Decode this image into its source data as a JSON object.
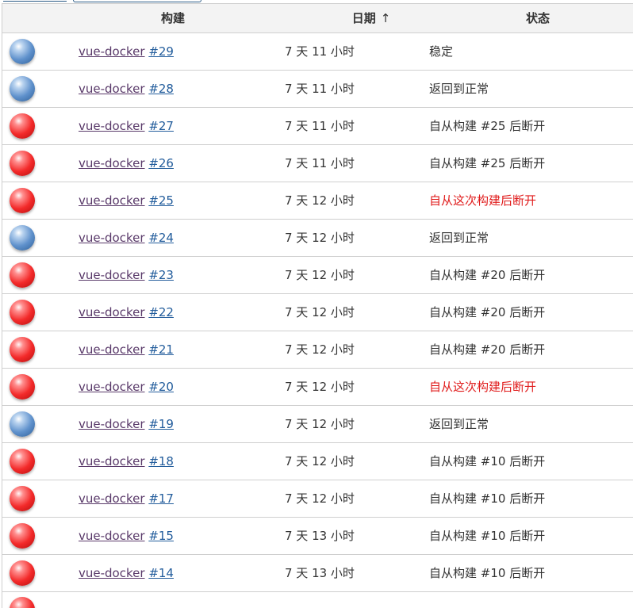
{
  "table": {
    "headers": {
      "build": "构建",
      "date": "日期",
      "date_sort_arrow": "↑",
      "status": "状态"
    },
    "rows": [
      {
        "color": "blue",
        "job": "vue-docker",
        "num": "#29",
        "date": "7 天 11 小时",
        "status": "稳定",
        "status_color": "#333333"
      },
      {
        "color": "blue",
        "job": "vue-docker",
        "num": "#28",
        "date": "7 天 11 小时",
        "status": "返回到正常",
        "status_color": "#333333"
      },
      {
        "color": "red",
        "job": "vue-docker",
        "num": "#27",
        "date": "7 天 11 小时",
        "status": "自从构建 #25 后断开",
        "status_color": "#333333"
      },
      {
        "color": "red",
        "job": "vue-docker",
        "num": "#26",
        "date": "7 天 11 小时",
        "status": "自从构建 #25 后断开",
        "status_color": "#333333"
      },
      {
        "color": "red",
        "job": "vue-docker",
        "num": "#25",
        "date": "7 天 12 小时",
        "status": "自从这次构建后断开",
        "status_color": "#e01b1b"
      },
      {
        "color": "blue",
        "job": "vue-docker",
        "num": "#24",
        "date": "7 天 12 小时",
        "status": "返回到正常",
        "status_color": "#333333"
      },
      {
        "color": "red",
        "job": "vue-docker",
        "num": "#23",
        "date": "7 天 12 小时",
        "status": "自从构建 #20 后断开",
        "status_color": "#333333"
      },
      {
        "color": "red",
        "job": "vue-docker",
        "num": "#22",
        "date": "7 天 12 小时",
        "status": "自从构建 #20 后断开",
        "status_color": "#333333"
      },
      {
        "color": "red",
        "job": "vue-docker",
        "num": "#21",
        "date": "7 天 12 小时",
        "status": "自从构建 #20 后断开",
        "status_color": "#333333"
      },
      {
        "color": "red",
        "job": "vue-docker",
        "num": "#20",
        "date": "7 天 12 小时",
        "status": "自从这次构建后断开",
        "status_color": "#e01b1b"
      },
      {
        "color": "blue",
        "job": "vue-docker",
        "num": "#19",
        "date": "7 天 12 小时",
        "status": "返回到正常",
        "status_color": "#333333"
      },
      {
        "color": "red",
        "job": "vue-docker",
        "num": "#18",
        "date": "7 天 12 小时",
        "status": "自从构建 #10 后断开",
        "status_color": "#333333"
      },
      {
        "color": "red",
        "job": "vue-docker",
        "num": "#17",
        "date": "7 天 12 小时",
        "status": "自从构建 #10 后断开",
        "status_color": "#333333"
      },
      {
        "color": "red",
        "job": "vue-docker",
        "num": "#15",
        "date": "7 天 13 小时",
        "status": "自从构建 #10 后断开",
        "status_color": "#333333"
      },
      {
        "color": "red",
        "job": "vue-docker",
        "num": "#14",
        "date": "7 天 13 小时",
        "status": "自从构建 #10 后断开",
        "status_color": "#333333"
      }
    ],
    "partial_row": {
      "color": "red"
    }
  }
}
